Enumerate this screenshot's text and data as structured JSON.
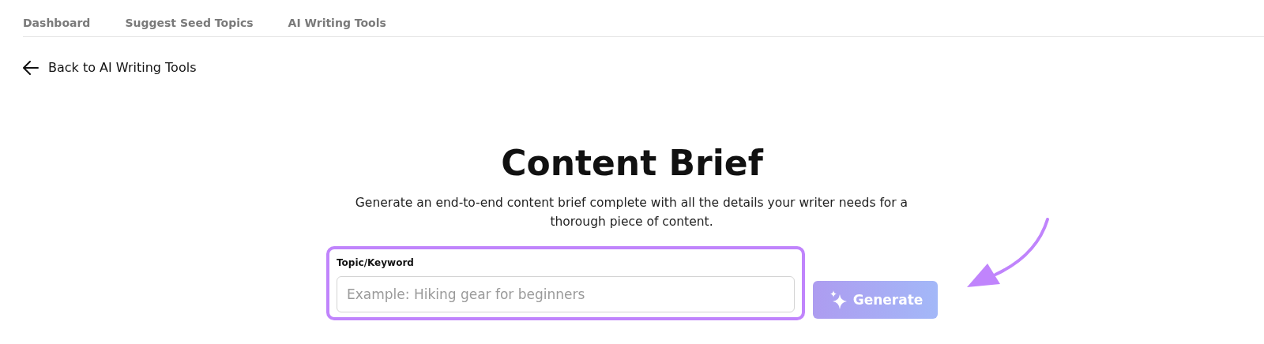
{
  "nav": {
    "items": [
      {
        "label": "Dashboard"
      },
      {
        "label": "Suggest Seed Topics"
      },
      {
        "label": "AI Writing Tools"
      }
    ]
  },
  "back_link": {
    "label": "Back to AI Writing Tools"
  },
  "title": "Content Brief",
  "description": "Generate an end-to-end content brief complete with all the details your writer needs for a thorough piece of content.",
  "form": {
    "field": {
      "label": "Topic/Keyword",
      "placeholder": "Example: Hiking gear for beginners",
      "highlighted": true
    },
    "button": {
      "label": "Generate",
      "disabled": true
    }
  }
}
